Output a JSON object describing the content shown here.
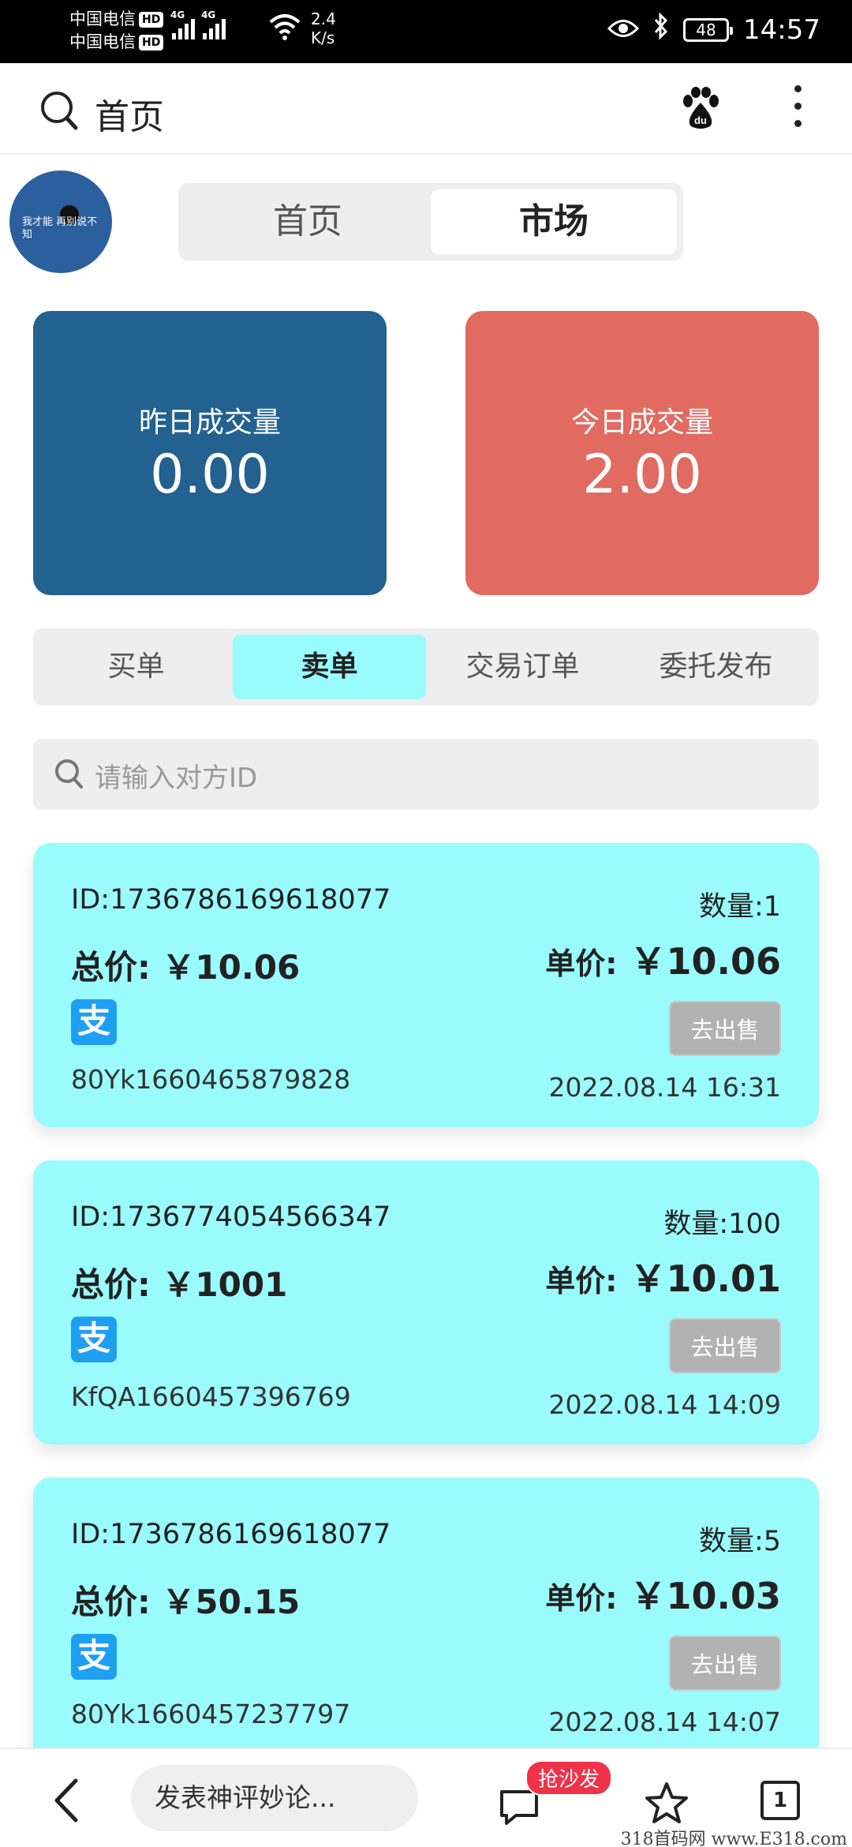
{
  "status_bar": {
    "carrier_1": "中国电信",
    "carrier_2": "中国电信",
    "hd": "HD",
    "net_type": "4G",
    "speed_value": "2.4",
    "speed_unit": "K/s",
    "battery": "48",
    "time": "14:57"
  },
  "header": {
    "title": "首页",
    "baidu_logo": "du"
  },
  "avatar": {
    "caption": "我才能 再别说不知"
  },
  "top_tabs": [
    {
      "label": "首页",
      "active": false
    },
    {
      "label": "市场",
      "active": true
    }
  ],
  "stats": {
    "yesterday_label": "昨日成交量",
    "yesterday_value": "0.00",
    "today_label": "今日成交量",
    "today_value": "2.00"
  },
  "sub_tabs": [
    {
      "label": "买单",
      "active": false
    },
    {
      "label": "卖单",
      "active": true
    },
    {
      "label": "交易订单",
      "active": false
    },
    {
      "label": "委托发布",
      "active": false
    }
  ],
  "search": {
    "placeholder": "请输入对方ID"
  },
  "orders": [
    {
      "id": "ID:1736786169618077",
      "quantity": "数量:1",
      "total_label": "总价:",
      "total_value": "￥10.06",
      "unit_label": "单价:",
      "unit_value": "￥10.06",
      "pay_icon": "支",
      "action": "去出售",
      "code": "80Yk1660465879828",
      "time": "2022.08.14 16:31"
    },
    {
      "id": "ID:1736774054566347",
      "quantity": "数量:100",
      "total_label": "总价:",
      "total_value": "￥1001",
      "unit_label": "单价:",
      "unit_value": "￥10.01",
      "pay_icon": "支",
      "action": "去出售",
      "code": "KfQA1660457396769",
      "time": "2022.08.14 14:09"
    },
    {
      "id": "ID:1736786169618077",
      "quantity": "数量:5",
      "total_label": "总价:",
      "total_value": "￥50.15",
      "unit_label": "单价:",
      "unit_value": "￥10.03",
      "pay_icon": "支",
      "action": "去出售",
      "code": "80Yk1660457237797",
      "time": "2022.08.14 14:07"
    }
  ],
  "bottom_bar": {
    "comment_placeholder": "发表神评妙论...",
    "badge": "抢沙发",
    "tab_count": "1"
  },
  "watermark": "318首码网 www.E318.com",
  "colors": {
    "yesterday_card": "#226190",
    "today_card": "#e16a61",
    "order_card": "#9afbfd",
    "active_subtab": "#98fbfd"
  }
}
